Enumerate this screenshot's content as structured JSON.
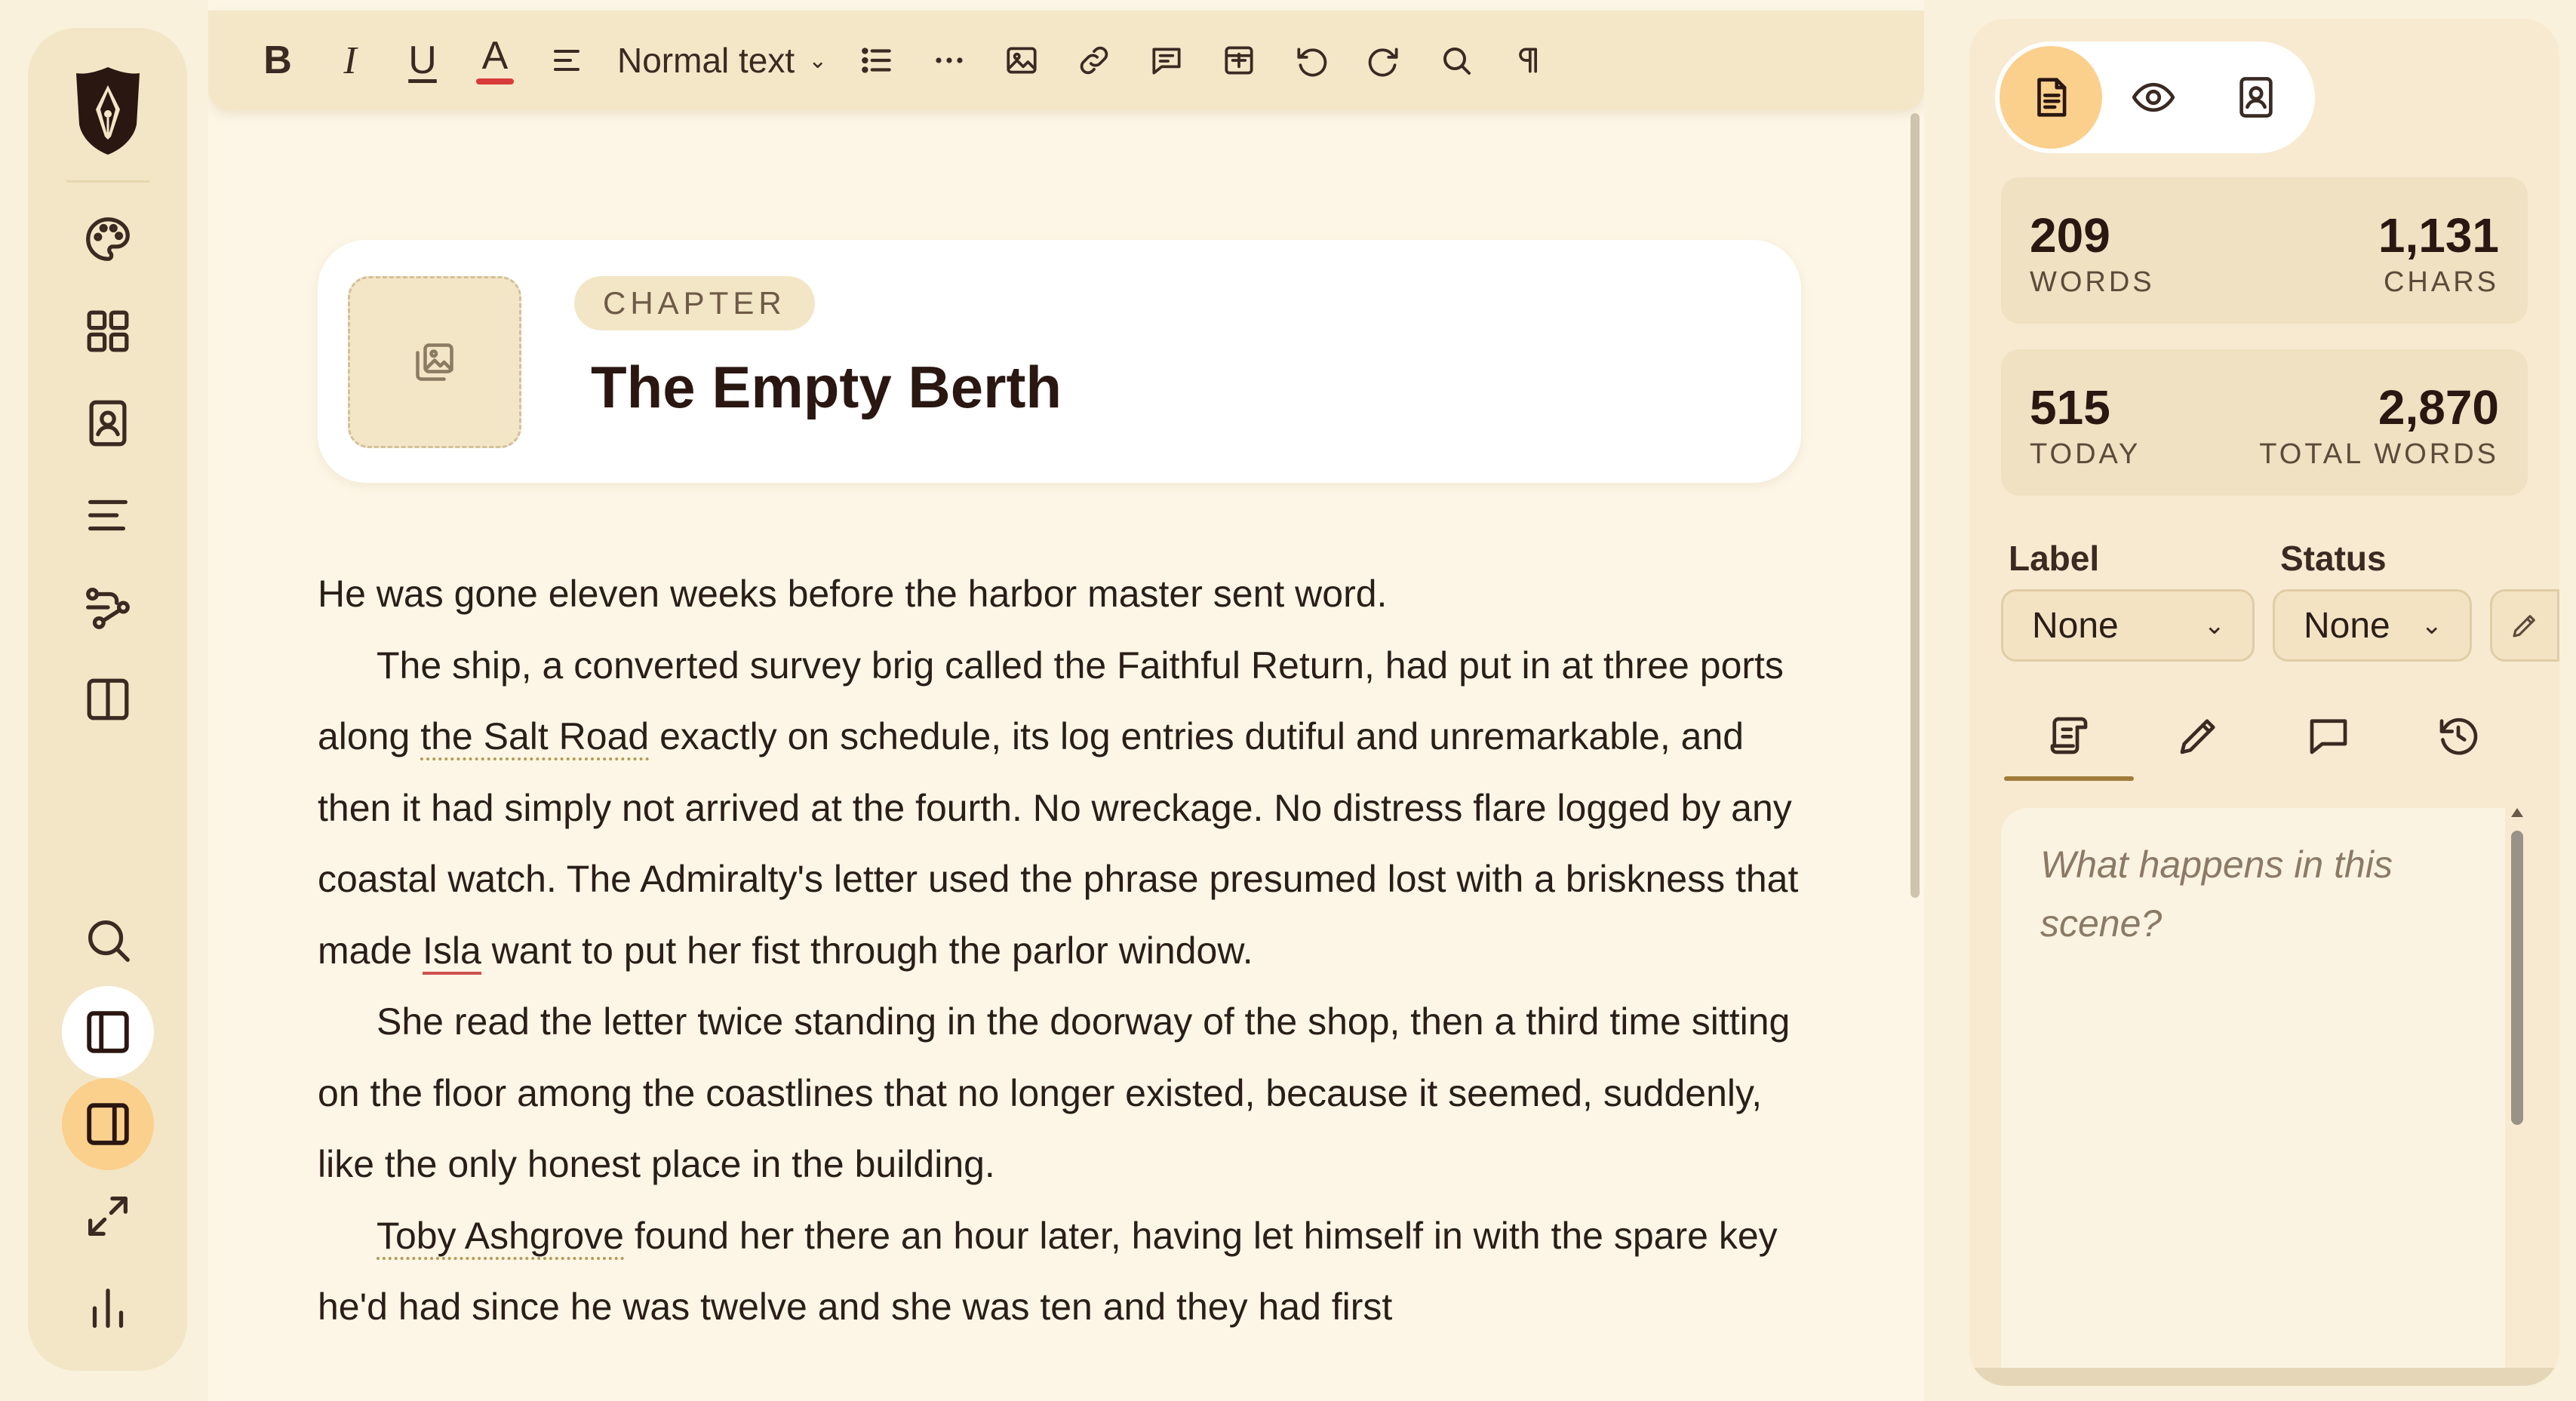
{
  "colors": {
    "page_bg": "#faf1dc",
    "editor_bg": "#fdf6e6",
    "accent": "#fbd08c",
    "underline_red": "#d93a3a",
    "text": "#2b1d18"
  },
  "rail": {
    "logo_icon": "quill-nib-shield-logo",
    "top_items": [
      "palette-icon",
      "grid-icon",
      "contact-card-icon",
      "outline-icon",
      "timeline-icon",
      "columns-icon"
    ],
    "bottom_items": [
      "search-icon",
      "left-panel-icon",
      "right-panel-icon",
      "expand-icon",
      "stats-icon"
    ]
  },
  "toolbar": {
    "bold": "B",
    "italic": "I",
    "underline": "U",
    "color": "A",
    "style_label": "Normal text"
  },
  "chapter": {
    "badge": "CHAPTER",
    "title": "The Empty Berth"
  },
  "manuscript": {
    "p1": "He was gone eleven weeks before the harbor master sent word.",
    "p2_a": "The ship, a converted survey brig called the Faithful Return, had put in at three ports along ",
    "p2_ref1": "the Salt Road",
    "p2_b": " exactly on schedule, its log entries dutiful and unremarkable, and then it had simply not arrived at the fourth. No wreckage. No distress flare logged by any coastal watch. The Admiralty's letter used the phrase presumed lost with a briskness that made ",
    "p2_ref2": "Isla",
    "p2_c": " want to put her fist through the parlor window.",
    "p3": "She read the letter twice standing in the doorway of the shop, then a third time sitting on the floor among the coastlines that no longer existed, because it seemed, suddenly, like the only honest place in the building.",
    "p4_ref": "Toby Ashgrove",
    "p4_a": " found her there an hour later, having let himself in with the spare key he'd had since he was twelve and she was ten and they had first"
  },
  "panel": {
    "view_modes": [
      "document-icon",
      "eye-icon",
      "contact-card-icon"
    ],
    "stats": {
      "words": "209",
      "words_label": "WORDS",
      "chars": "1,131",
      "chars_label": "CHARS",
      "today": "515",
      "today_label": "TODAY",
      "total": "2,870",
      "total_label": "TOTAL WORDS"
    },
    "label": {
      "title": "Label",
      "value": "None"
    },
    "status": {
      "title": "Status",
      "value": "None"
    },
    "tabs": [
      "scroll-icon",
      "pencil-icon",
      "comment-icon",
      "history-icon"
    ],
    "notes_placeholder": "What happens in this scene?"
  }
}
